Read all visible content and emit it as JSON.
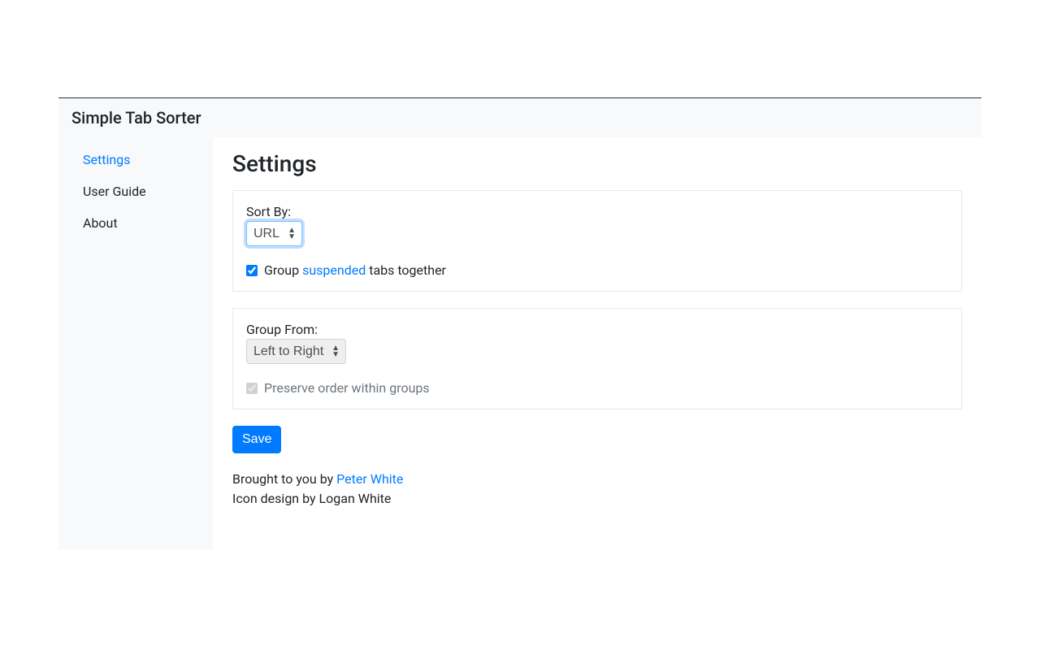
{
  "header": {
    "brand": "Simple Tab Sorter"
  },
  "sidebar": {
    "items": [
      {
        "label": "Settings",
        "active": true
      },
      {
        "label": "User Guide",
        "active": false
      },
      {
        "label": "About",
        "active": false
      }
    ]
  },
  "content": {
    "title": "Settings",
    "card1": {
      "sort_by_label": "Sort By:",
      "sort_by_value": "URL",
      "group_suspended_prefix": "Group ",
      "group_suspended_link": "suspended",
      "group_suspended_suffix": " tabs together",
      "group_suspended_checked": true
    },
    "card2": {
      "group_from_label": "Group From:",
      "group_from_value": "Left to Right",
      "preserve_order_label": "Preserve order within groups",
      "preserve_order_checked": true,
      "preserve_order_disabled": true
    },
    "save_button": "Save"
  },
  "footer": {
    "brought_prefix": "Brought to you by ",
    "author_link": "Peter White",
    "icon_credit": "Icon design by Logan White"
  }
}
